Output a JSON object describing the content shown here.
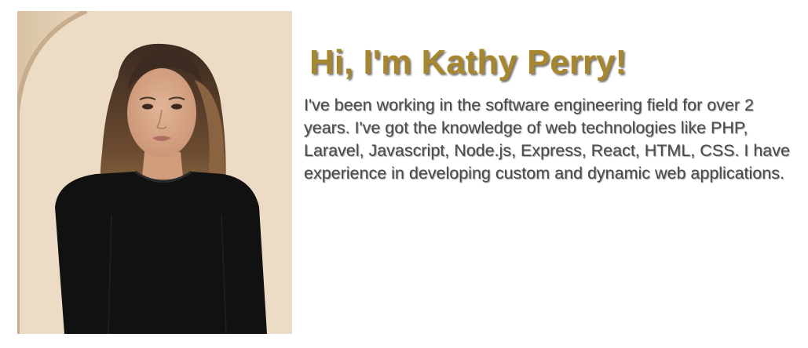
{
  "hero": {
    "heading": "Hi, I'm Kathy Perry!",
    "bio": "I've been working in the software engineering field for over 2 years. I've got the knowledge of web technologies like PHP, Laravel, Javascript, Node.js, Express, React, HTML, CSS. I have experience in developing custom and dynamic web applications.",
    "photo_icon": "portrait-photo",
    "colors": {
      "heading": "#a8862c",
      "text": "#4a4a4a",
      "photo_background": "#e8d6c1"
    }
  }
}
